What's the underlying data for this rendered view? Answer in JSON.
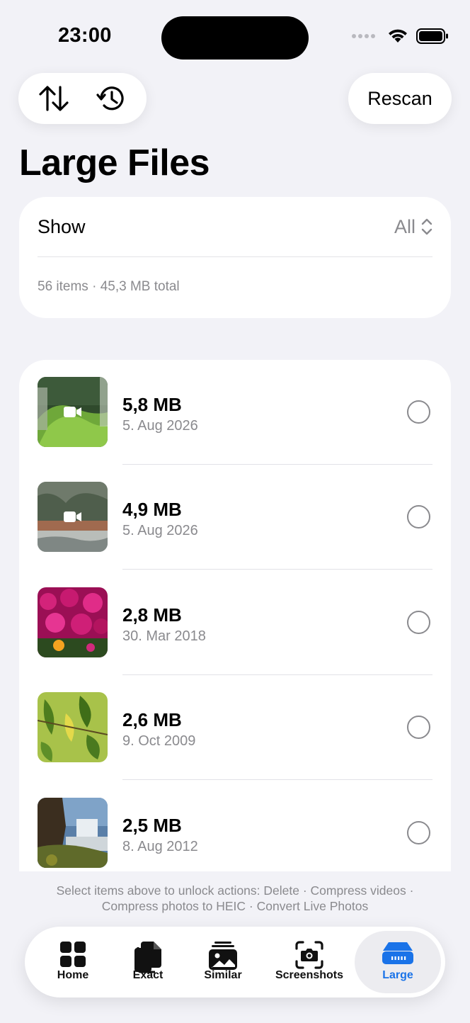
{
  "status_bar": {
    "time": "23:00"
  },
  "toolbar": {
    "rescan_label": "Rescan"
  },
  "page": {
    "title": "Large Files"
  },
  "filter": {
    "show_label": "Show",
    "show_value": "All",
    "summary": "56 items · 45,3 MB total"
  },
  "files": [
    {
      "size": "5,8 MB",
      "date": "5. Aug 2026",
      "is_video": true,
      "selected": false
    },
    {
      "size": "4,9 MB",
      "date": "5. Aug 2026",
      "is_video": true,
      "selected": false
    },
    {
      "size": "2,8 MB",
      "date": "30. Mar 2018",
      "is_video": false,
      "selected": false
    },
    {
      "size": "2,6 MB",
      "date": "9. Oct 2009",
      "is_video": false,
      "selected": false
    },
    {
      "size": "2,5 MB",
      "date": "8. Aug 2012",
      "is_video": false,
      "selected": false
    }
  ],
  "hint": {
    "line1": "Select items above to unlock actions: Delete · Compress videos ·",
    "line2": "Compress photos to HEIC · Convert Live Photos"
  },
  "tabs": [
    {
      "label": "Home",
      "icon": "grid-icon"
    },
    {
      "label": "Exact",
      "icon": "duplicate-docs-icon"
    },
    {
      "label": "Similar",
      "icon": "photo-stack-icon"
    },
    {
      "label": "Screenshots",
      "icon": "camera-viewfinder-icon"
    },
    {
      "label": "Large",
      "icon": "storage-drive-icon",
      "active": true
    }
  ],
  "colors": {
    "accent": "#1a73e8",
    "background": "#f2f2f7",
    "secondary_text": "#8a8a8e"
  }
}
